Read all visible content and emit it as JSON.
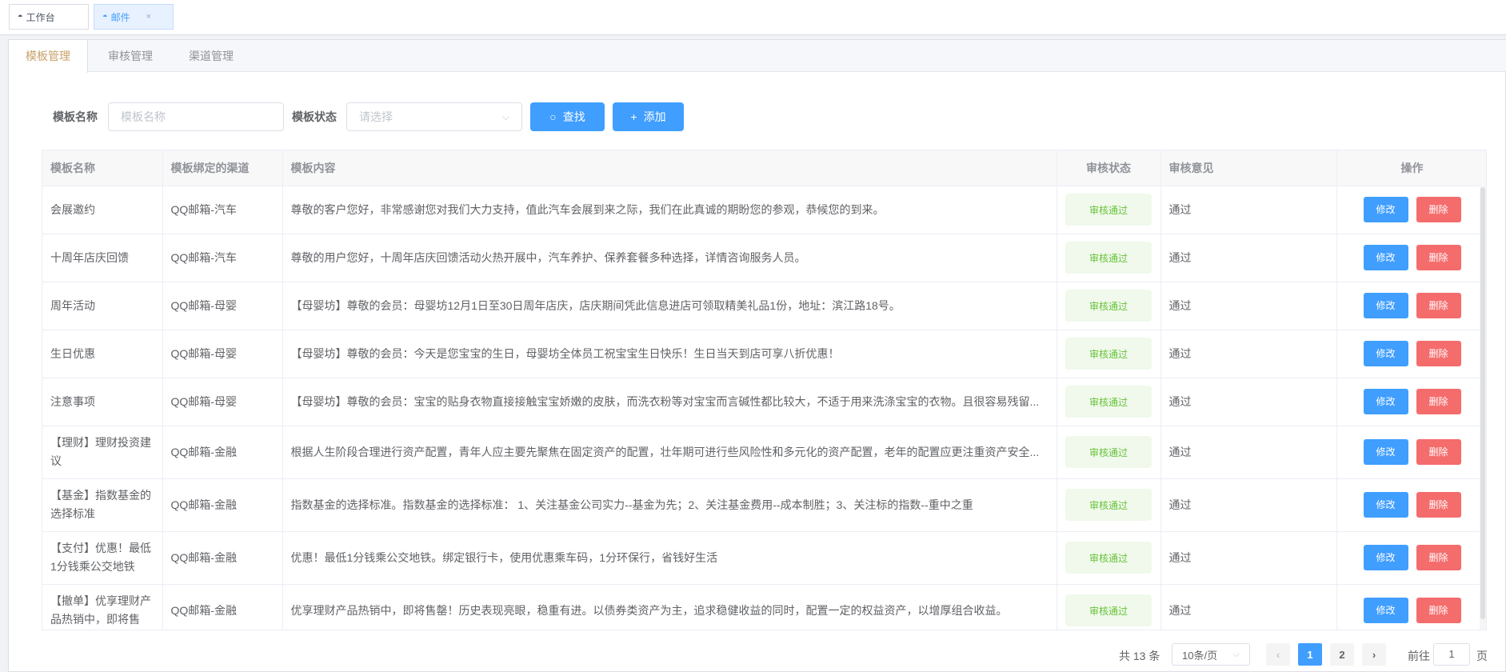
{
  "tags": [
    {
      "label": "工作台",
      "icon": "dashboard-icon",
      "active": false
    },
    {
      "label": "邮件",
      "icon": "dashboard-icon",
      "active": true,
      "close": "×"
    }
  ],
  "tabs": [
    {
      "label": "模板管理",
      "active": true
    },
    {
      "label": "审核管理",
      "active": false
    },
    {
      "label": "渠道管理",
      "active": false
    }
  ],
  "search": {
    "name_label": "模板名称",
    "name_placeholder": "模板名称",
    "status_label": "模板状态",
    "status_placeholder": "请选择",
    "find_button": "查找",
    "add_button": "添加"
  },
  "table": {
    "columns": [
      "模板名称",
      "模板绑定的渠道",
      "模板内容",
      "审核状态",
      "审核意见",
      "操作"
    ],
    "edit_label": "修改",
    "delete_label": "删除",
    "rows": [
      {
        "name": "会展邀约",
        "channel": "QQ邮箱-汽车",
        "content": "尊敬的客户您好，非常感谢您对我们大力支持，值此汽车会展到来之际，我们在此真诚的期盼您的参观，恭候您的到来。",
        "status": "审核通过",
        "opinion": "通过"
      },
      {
        "name": "十周年店庆回馈",
        "channel": "QQ邮箱-汽车",
        "content": "尊敬的用户您好，十周年店庆回馈活动火热开展中，汽车养护、保养套餐多种选择，详情咨询服务人员。",
        "status": "审核通过",
        "opinion": "通过"
      },
      {
        "name": "周年活动",
        "channel": "QQ邮箱-母婴",
        "content": "【母婴坊】尊敬的会员：母婴坊12月1日至30日周年店庆，店庆期间凭此信息进店可领取精美礼品1份，地址：滨江路18号。",
        "status": "审核通过",
        "opinion": "通过"
      },
      {
        "name": "生日优惠",
        "channel": "QQ邮箱-母婴",
        "content": "【母婴坊】尊敬的会员：今天是您宝宝的生日，母婴坊全体员工祝宝宝生日快乐！生日当天到店可享八折优惠！",
        "status": "审核通过",
        "opinion": "通过"
      },
      {
        "name": "注意事项",
        "channel": "QQ邮箱-母婴",
        "content": "【母婴坊】尊敬的会员：宝宝的贴身衣物直接接触宝宝娇嫩的皮肤，而洗衣粉等对宝宝而言碱性都比较大，不适于用来洗涤宝宝的衣物。且很容易残留...",
        "status": "审核通过",
        "opinion": "通过"
      },
      {
        "name": "【理财】理财投资建议",
        "channel": "QQ邮箱-金融",
        "content": "根据人生阶段合理进行资产配置，青年人应主要先聚焦在固定资产的配置，壮年期可进行些风险性和多元化的资产配置，老年的配置应更注重资产安全...",
        "status": "审核通过",
        "opinion": "通过"
      },
      {
        "name": "【基金】指数基金的选择标准",
        "channel": "QQ邮箱-金融",
        "content": "指数基金的选择标准。指数基金的选择标准： 1、关注基金公司实力--基金为先；2、关注基金费用--成本制胜；3、关注标的指数--重中之重",
        "status": "审核通过",
        "opinion": "通过"
      },
      {
        "name": "【支付】优惠！最低1分钱乘公交地铁",
        "channel": "QQ邮箱-金融",
        "content": "优惠！最低1分钱乘公交地铁。绑定银行卡，使用优惠乘车码，1分环保行，省钱好生活",
        "status": "审核通过",
        "opinion": "通过"
      },
      {
        "name": "【撤单】优享理财产品热销中，即将售",
        "channel": "QQ邮箱-金融",
        "content": "优享理财产品热销中，即将售罄！历史表现亮眼，稳重有进。以债券类资产为主，追求稳健收益的同时，配置一定的权益资产，以增厚组合收益。",
        "status": "审核通过",
        "opinion": "通过"
      }
    ]
  },
  "pagination": {
    "total": "共 13 条",
    "page_size": "10条/页",
    "pages": [
      "1",
      "2"
    ],
    "current": "1",
    "goto_label": "前往",
    "goto_value": "1",
    "goto_suffix": "页",
    "prev": "‹",
    "next": "›"
  },
  "colors": {
    "primary": "#409eff",
    "danger": "#f56c6c",
    "success": "#67c23a"
  }
}
